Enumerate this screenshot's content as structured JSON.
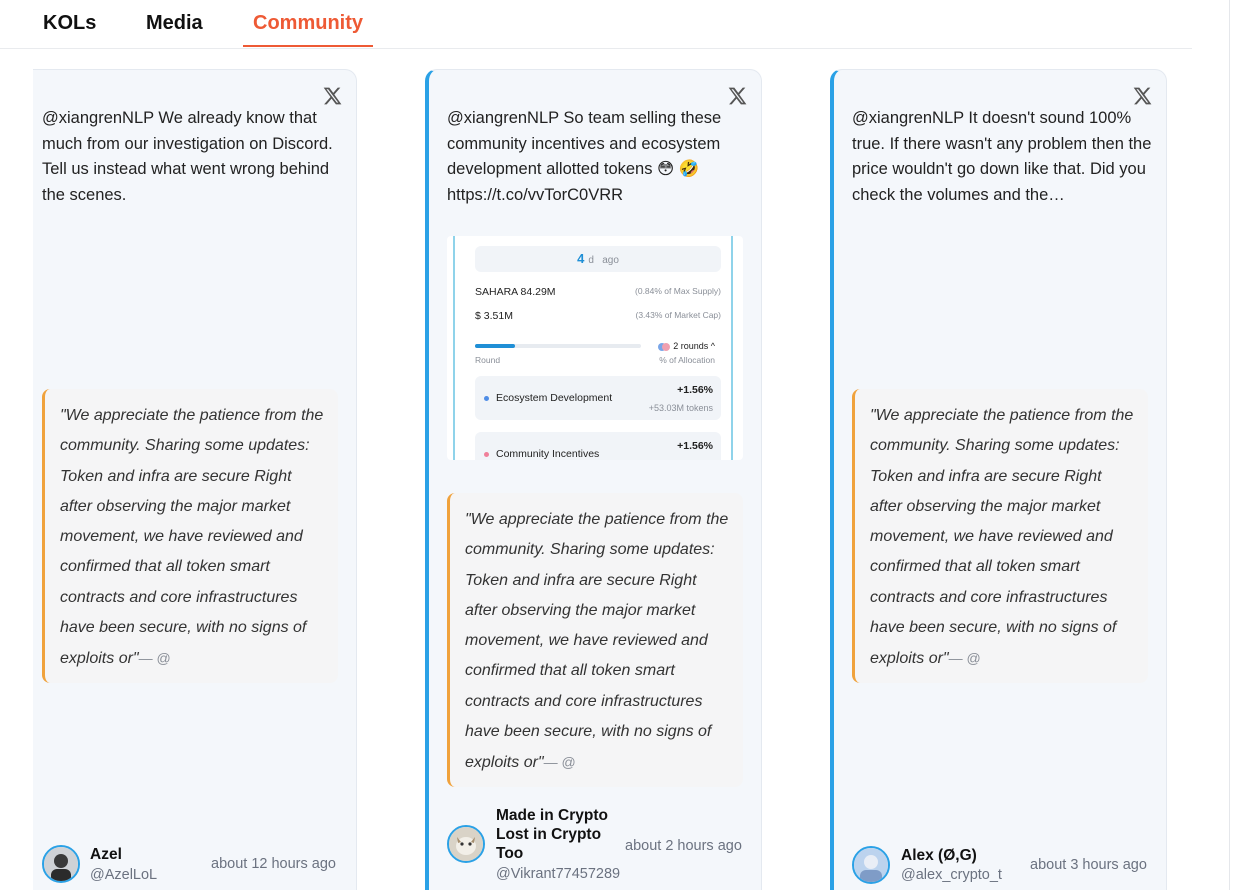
{
  "tabs": {
    "kols": "KOLs",
    "media": "Media",
    "community": "Community",
    "active": "Community",
    "accent_color": "#ee5a35"
  },
  "cards": [
    {
      "icon": "x-logo-icon",
      "text": "@xiangrenNLP We already know that much from our investigation on Discord. Tell us instead what went wrong behind the scenes.",
      "quote": "\"We appreciate the patience from the community. Sharing some updates: Token and infra are secure Right after observing the major market movement, we have reviewed and confirmed that all token smart contracts and core infrastructures have been secure, with no signs of exploits or\"",
      "quote_suffix": "— @",
      "author": {
        "name": "Azel",
        "handle": "@AzelLoL",
        "time": "about 12 hours ago"
      }
    },
    {
      "icon": "x-logo-icon",
      "text": "@xiangrenNLP So team selling these community incentives and ecosystem development allotted tokens 😳 🤣",
      "link": "https://t.co/vvTorC0VRR",
      "embed": {
        "days_value": "4",
        "days_unit": "d",
        "days_suffix": "ago",
        "supply_amount": "SAHARA 84.29M",
        "supply_note": "(0.84% of Max Supply)",
        "usd_amount": "$ 3.51M",
        "usd_note": "(3.43% of Market Cap)",
        "rounds": "2 rounds ^",
        "round_label": "Round",
        "allocation_label": "% of Allocation",
        "round_progress": 0.24,
        "items": [
          {
            "name": "Ecosystem Development",
            "pct": "+1.56%",
            "tokens": "+53.03M tokens",
            "color": "#4f8de6"
          },
          {
            "name": "Community Incentives",
            "pct": "+1.56%",
            "tokens": "",
            "color": "#f07f99"
          }
        ]
      },
      "quote": "\"We appreciate the patience from the community. Sharing some updates: Token and infra are secure Right after observing the major market movement, we have reviewed and confirmed that all token smart contracts and core infrastructures have been secure, with no signs of exploits or\"",
      "quote_suffix": "— @",
      "author": {
        "name": "Made in Crypto Lost in Crypto Too",
        "handle": "@Vikrant77457289",
        "time": "about 2 hours ago"
      }
    },
    {
      "icon": "x-logo-icon",
      "text": "@xiangrenNLP It doesn't sound 100% true. If there wasn't any problem then the price wouldn't go down like that. Did you check the volumes and the…",
      "quote": "\"We appreciate the patience from the community. Sharing some updates: Token and infra are secure Right after observing the major market movement, we have reviewed and confirmed that all token smart contracts and core infrastructures have been secure, with no signs of exploits or\"",
      "quote_suffix": "— @",
      "author": {
        "name": "Alex (Ø,G)",
        "handle": "@alex_crypto_t",
        "time": "about 3 hours ago"
      }
    }
  ],
  "colors": {
    "card_accent": "#2aa1e6",
    "quote_accent": "#f0a23c"
  }
}
